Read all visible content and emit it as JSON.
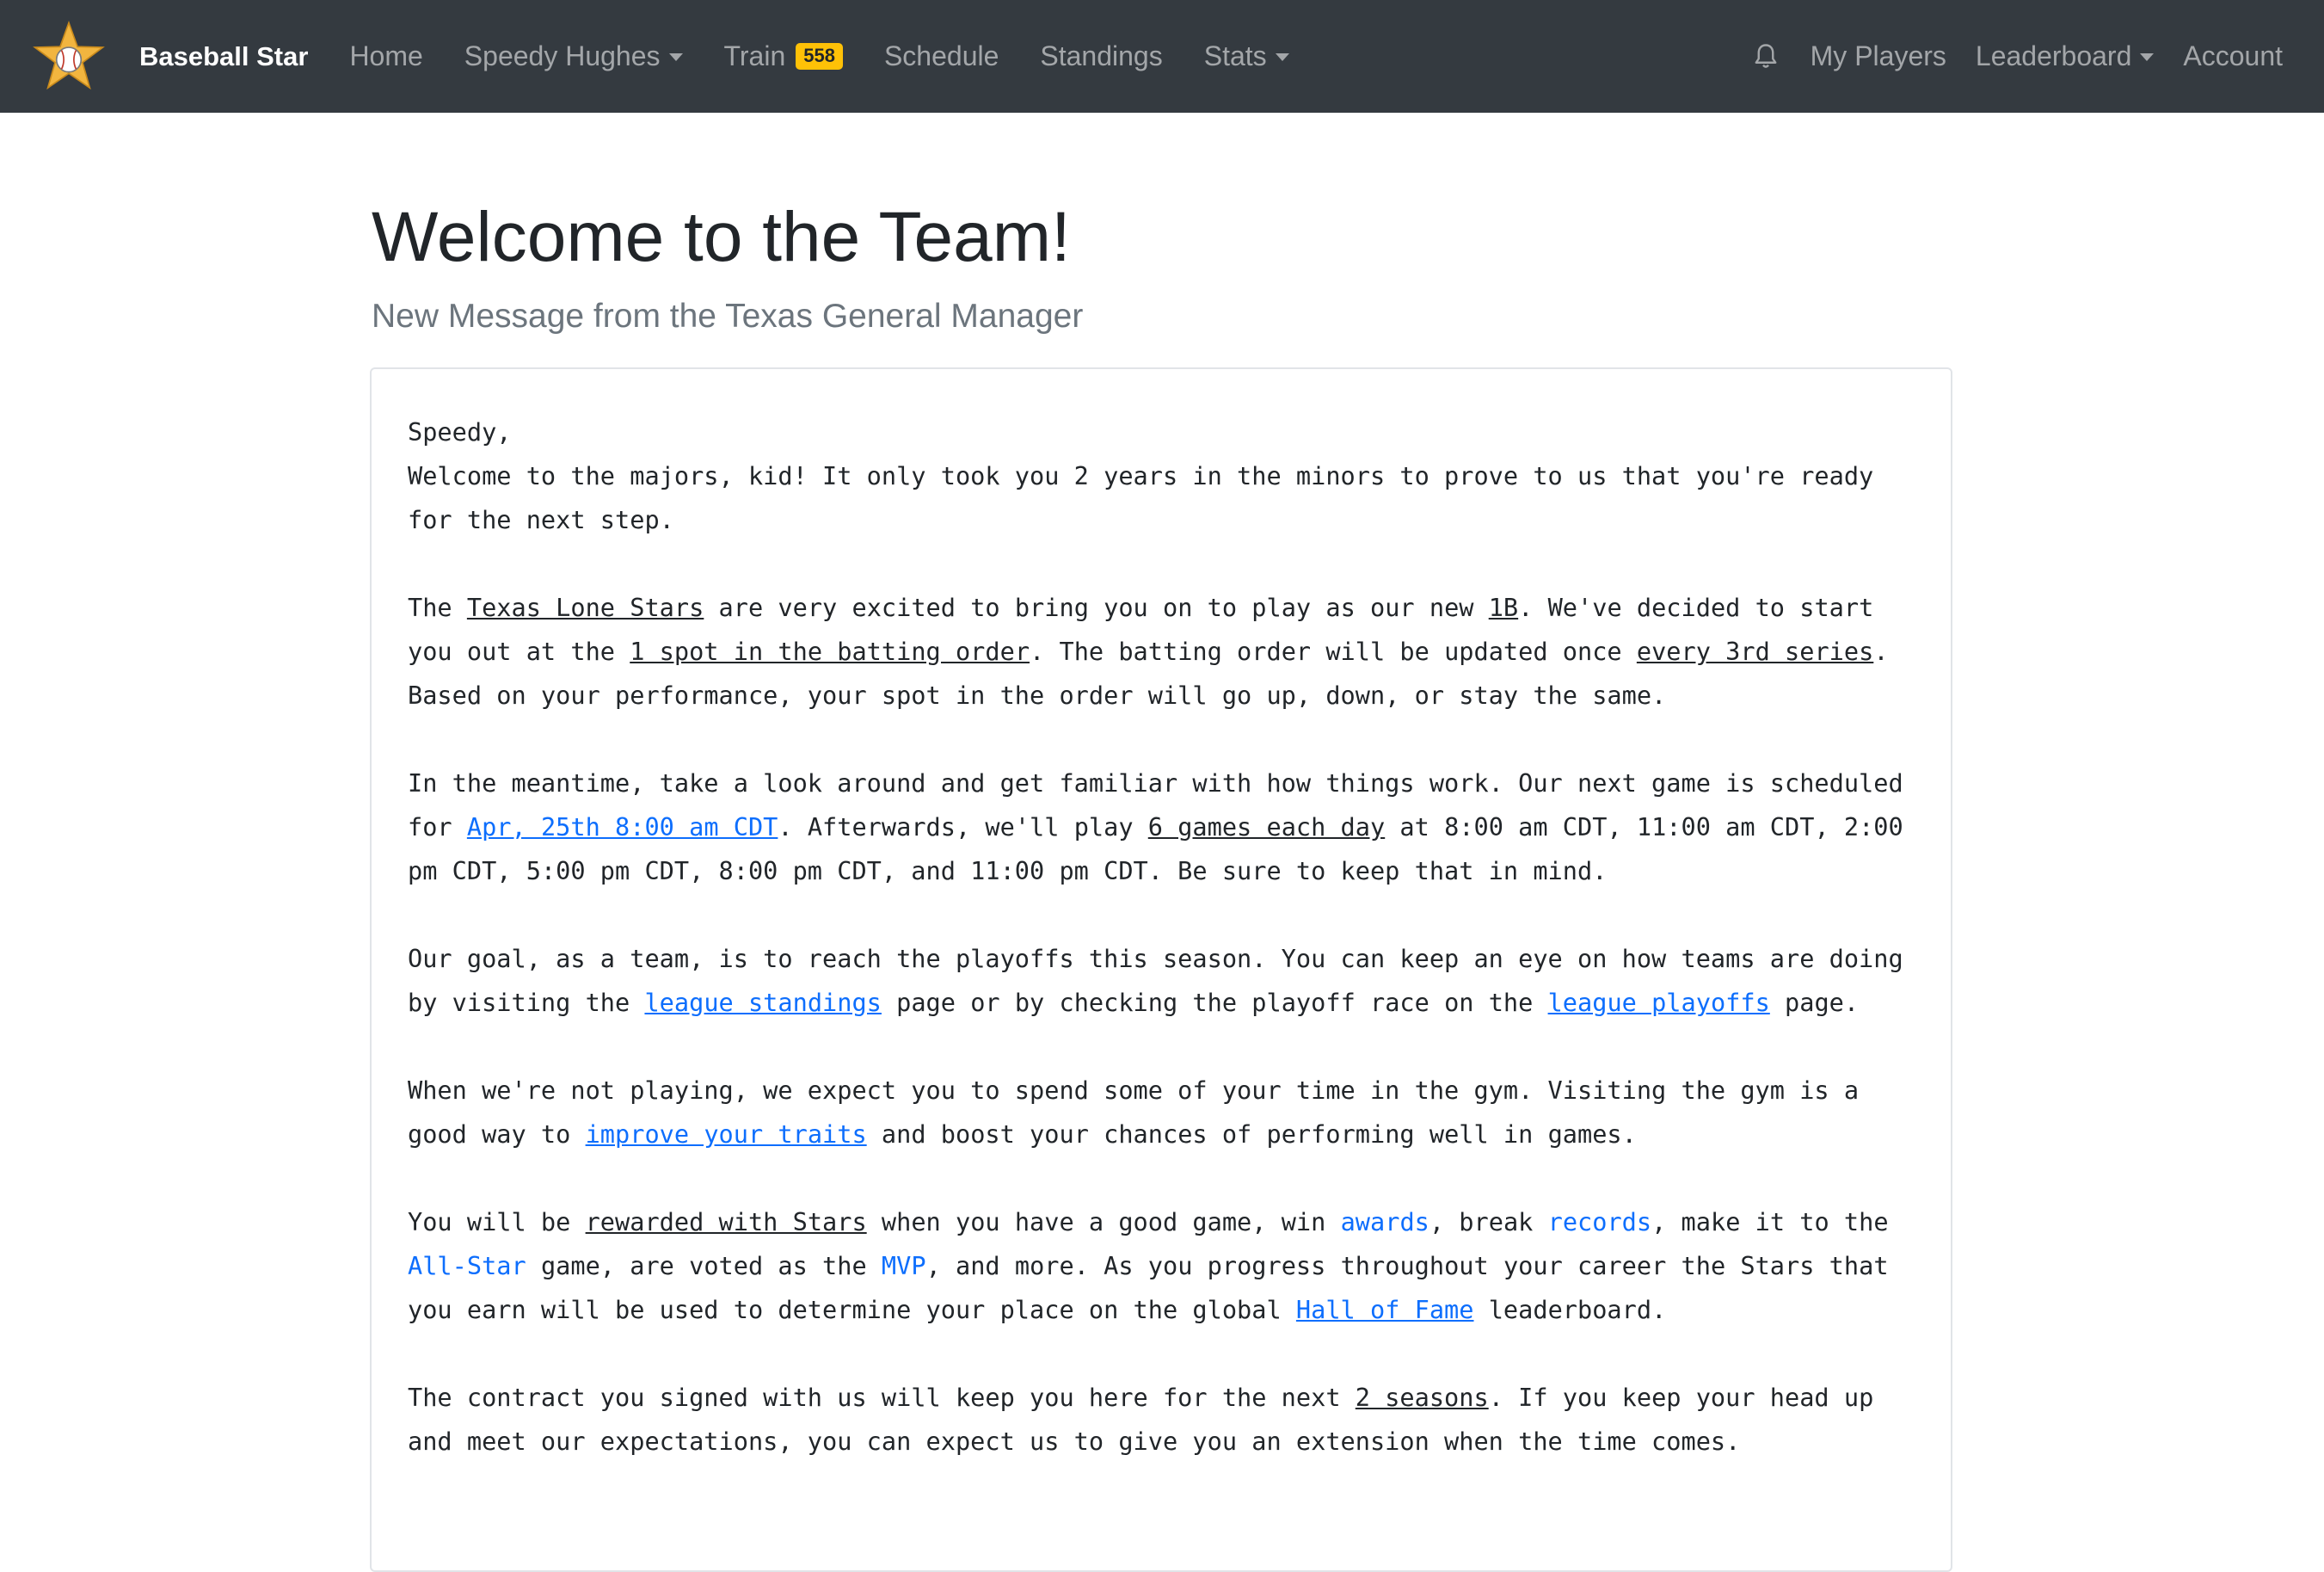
{
  "nav": {
    "brand": "Baseball Star",
    "items": {
      "home": "Home",
      "player": "Speedy Hughes",
      "train": "Train",
      "train_badge": "558",
      "schedule": "Schedule",
      "standings": "Standings",
      "stats": "Stats"
    },
    "right": {
      "my_players": "My Players",
      "leaderboard": "Leaderboard",
      "account": "Account"
    },
    "colors": {
      "background": "#343a40",
      "badge": "#ffc107",
      "logo_star": "#f2b53f"
    }
  },
  "page": {
    "title": "Welcome to the Team!",
    "subtitle": "New Message from the Texas General Manager"
  },
  "message": {
    "greeting": "Speedy,",
    "p1": "Welcome to the majors, kid! It only took you 2 years in the minors to prove to us that you're ready for the next step.",
    "p2": {
      "t1": "The ",
      "team": "Texas Lone Stars",
      "t2": " are very excited to bring you on to play as our new ",
      "position": "1B",
      "t3": ". We've decided to start you out at the ",
      "spot": "1 spot in the batting order",
      "t4": ". The batting order will be updated once ",
      "every": "every 3rd series",
      "t5": ". Based on your performance, your spot in the order will go up, down, or stay the same."
    },
    "p3": {
      "t1": "In the meantime, take a look around and get familiar with how things work. Our next game is scheduled for ",
      "next_game": "Apr, 25th 8:00 am CDT",
      "t2": ". Afterwards, we'll play ",
      "games": "6 games each day",
      "t3": " at 8:00 am CDT, 11:00 am CDT, 2:00 pm CDT, 5:00 pm CDT, 8:00 pm CDT, and 11:00 pm CDT. Be sure to keep that in mind."
    },
    "p4": {
      "t1": "Our goal, as a team, is to reach the playoffs this season. You can keep an eye on how teams are doing by visiting the ",
      "standings": "league standings",
      "t2": " page or by checking the playoff race on the ",
      "playoffs": "league playoffs",
      "t3": " page."
    },
    "p5": {
      "t1": "When we're not playing, we expect you to spend some of your time in the gym. Visiting the gym is a good way to ",
      "traits": "improve your traits",
      "t2": " and boost your chances of performing well in games."
    },
    "p6": {
      "t1": "You will be ",
      "rewarded": "rewarded with Stars",
      "t2": " when you have a good game, win ",
      "awards": "awards",
      "t3": ", break ",
      "records": "records",
      "t4": ", make it to the ",
      "allstar": "All-Star",
      "t5": " game, are voted as the ",
      "mvp": "MVP",
      "t6": ", and more. As you progress throughout your career the Stars that you earn will be used to determine your place on the global ",
      "hof": "Hall of Fame",
      "t7": " leaderboard."
    },
    "p7": {
      "t1": "The contract you signed with us will keep you here for the next ",
      "seasons": "2 seasons",
      "t2": ". If you keep your head up and meet our expectations, you can expect us to give you an extension when the time comes."
    },
    "link_color": "#0d6efd"
  }
}
